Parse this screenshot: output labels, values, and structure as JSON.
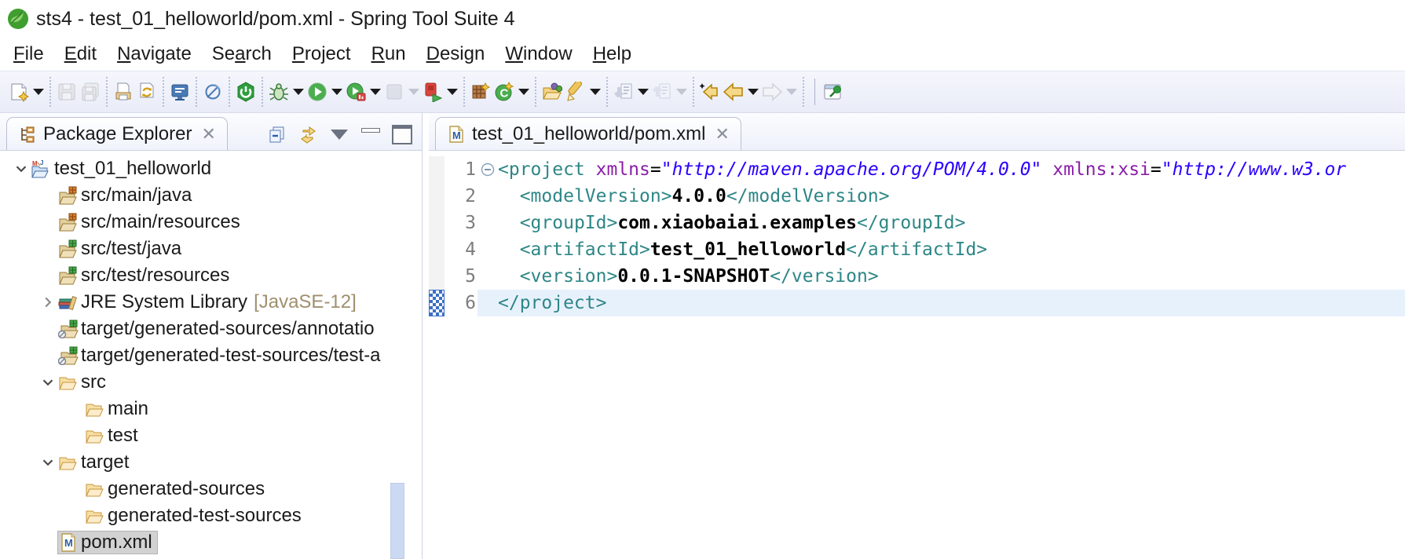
{
  "window": {
    "title": "sts4 - test_01_helloworld/pom.xml - Spring Tool Suite 4",
    "app_icon": "spring-leaf"
  },
  "menu_bar": {
    "items": [
      {
        "label": "File",
        "mn": 0
      },
      {
        "label": "Edit",
        "mn": 0
      },
      {
        "label": "Navigate",
        "mn": 0
      },
      {
        "label": "Search",
        "mn": 2
      },
      {
        "label": "Project",
        "mn": 0
      },
      {
        "label": "Run",
        "mn": 0
      },
      {
        "label": "Design",
        "mn": 0
      },
      {
        "label": "Window",
        "mn": 0
      },
      {
        "label": "Help",
        "mn": 0
      }
    ]
  },
  "toolbar": {
    "groups": [
      [
        {
          "icon": "new",
          "dropdown": true
        }
      ],
      [
        {
          "icon": "save",
          "disabled": true
        },
        {
          "icon": "save-all",
          "disabled": true
        }
      ],
      [
        {
          "icon": "print"
        },
        {
          "icon": "refresh"
        }
      ],
      [
        {
          "icon": "console"
        }
      ],
      [
        {
          "icon": "skip-breakpoints"
        }
      ],
      [
        {
          "icon": "boot-dashboard"
        }
      ],
      [
        {
          "icon": "debug",
          "dropdown": true
        },
        {
          "icon": "run",
          "dropdown": true
        },
        {
          "icon": "profile",
          "dropdown": true
        },
        {
          "icon": "stop",
          "disabled": true,
          "dropdown": true
        },
        {
          "icon": "relaunch",
          "dropdown": true
        }
      ],
      [
        {
          "icon": "new-project"
        },
        {
          "icon": "new-class",
          "dropdown": true
        }
      ],
      [
        {
          "icon": "open-task"
        },
        {
          "icon": "highlighter",
          "dropdown": true
        }
      ],
      [
        {
          "icon": "next-annotation",
          "dropdown": true
        },
        {
          "icon": "previous-annotation",
          "disabled": true,
          "dropdown": true
        }
      ],
      [
        {
          "icon": "last-edit-location"
        },
        {
          "icon": "back",
          "dropdown": true
        },
        {
          "icon": "forward",
          "disabled": true,
          "dropdown": true
        }
      ],
      [
        {
          "icon": "pin-editor",
          "sep_before": true
        }
      ]
    ]
  },
  "package_explorer": {
    "tab_label": "Package Explorer",
    "view_tool_icons": [
      "collapse-all",
      "link-with-editor",
      "view-menu",
      "minimize",
      "maximize"
    ],
    "tree": [
      {
        "depth": 0,
        "expander": "down",
        "icon": "maven-project",
        "label": "test_01_helloworld"
      },
      {
        "depth": 1,
        "expander": null,
        "icon": "pkg-folder",
        "label": "src/main/java"
      },
      {
        "depth": 1,
        "expander": null,
        "icon": "pkg-folder",
        "label": "src/main/resources"
      },
      {
        "depth": 1,
        "expander": null,
        "icon": "pkg-folder-test",
        "label": "src/test/java"
      },
      {
        "depth": 1,
        "expander": null,
        "icon": "pkg-folder-test",
        "label": "src/test/resources"
      },
      {
        "depth": 1,
        "expander": "right",
        "icon": "library",
        "label": "JRE System Library",
        "suffix": "[JavaSE-12]"
      },
      {
        "depth": 1,
        "expander": null,
        "icon": "pkg-folder-excluded",
        "label": "target/generated-sources/annotatio"
      },
      {
        "depth": 1,
        "expander": null,
        "icon": "pkg-folder-excluded",
        "label": "target/generated-test-sources/test-a"
      },
      {
        "depth": 1,
        "expander": "down",
        "icon": "folder",
        "label": "src"
      },
      {
        "depth": 2,
        "expander": null,
        "icon": "folder",
        "label": "main"
      },
      {
        "depth": 2,
        "expander": null,
        "icon": "folder",
        "label": "test"
      },
      {
        "depth": 1,
        "expander": "down",
        "icon": "folder",
        "label": "target"
      },
      {
        "depth": 2,
        "expander": null,
        "icon": "folder",
        "label": "generated-sources"
      },
      {
        "depth": 2,
        "expander": null,
        "icon": "folder",
        "label": "generated-test-sources"
      },
      {
        "depth": 1,
        "expander": null,
        "icon": "maven-file",
        "label": "pom.xml",
        "selected": true
      }
    ]
  },
  "editor": {
    "tab_label": "test_01_helloworld/pom.xml",
    "tab_icon": "maven-file",
    "lines": [
      {
        "num": "1",
        "fold": true,
        "tokens": [
          {
            "c": "tag",
            "t": "<project"
          },
          {
            "c": "plain",
            "t": " "
          },
          {
            "c": "attr",
            "t": "xmlns"
          },
          {
            "c": "plain",
            "t": "="
          },
          {
            "c": "val",
            "t": "\"http://maven.apache.org/POM/4.0.0\""
          },
          {
            "c": "plain",
            "t": " "
          },
          {
            "c": "attr",
            "t": "xmlns:xsi"
          },
          {
            "c": "plain",
            "t": "="
          },
          {
            "c": "val",
            "t": "\"http://www.w3.or"
          }
        ]
      },
      {
        "num": "2",
        "tokens": [
          {
            "c": "plain",
            "t": "  "
          },
          {
            "c": "tag",
            "t": "<modelVersion>"
          },
          {
            "c": "text",
            "t": "4.0.0"
          },
          {
            "c": "tag",
            "t": "</modelVersion>"
          }
        ]
      },
      {
        "num": "3",
        "tokens": [
          {
            "c": "plain",
            "t": "  "
          },
          {
            "c": "tag",
            "t": "<groupId>"
          },
          {
            "c": "text",
            "t": "com.xiaobaiai.examples"
          },
          {
            "c": "tag",
            "t": "</groupId>"
          }
        ]
      },
      {
        "num": "4",
        "tokens": [
          {
            "c": "plain",
            "t": "  "
          },
          {
            "c": "tag",
            "t": "<artifactId>"
          },
          {
            "c": "text",
            "t": "test_01_helloworld"
          },
          {
            "c": "tag",
            "t": "</artifactId>"
          }
        ]
      },
      {
        "num": "5",
        "tokens": [
          {
            "c": "plain",
            "t": "  "
          },
          {
            "c": "tag",
            "t": "<version>"
          },
          {
            "c": "text",
            "t": "0.0.1-SNAPSHOT"
          },
          {
            "c": "tag",
            "t": "</version>"
          }
        ]
      },
      {
        "num": "6",
        "highlighted": true,
        "marked": true,
        "tokens": [
          {
            "c": "tag",
            "t": "</project>"
          }
        ]
      }
    ]
  },
  "colors": {
    "tag": "#2e8686",
    "attribute": "#8a1fa8",
    "attr_value": "#2a00ff",
    "content": "#000000",
    "current_line": "#e7f1fc",
    "selection_gray": "#d2d2d2",
    "toolbar_bg": "#eceff9",
    "spring_green": "#5fb832"
  }
}
